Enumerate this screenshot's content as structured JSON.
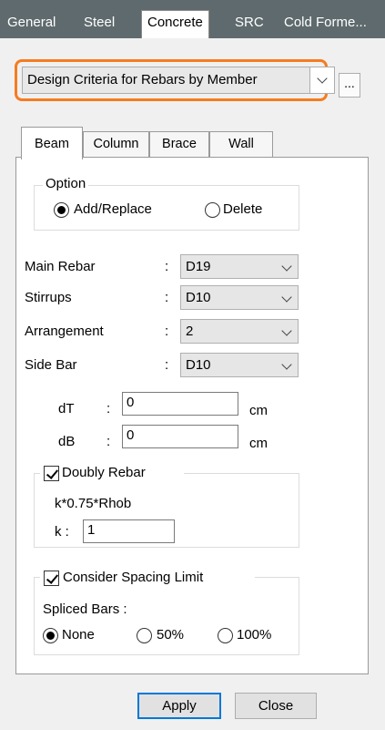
{
  "top_tabs": {
    "general": "General",
    "steel": "Steel",
    "concrete": "Concrete",
    "src": "SRC",
    "cold_formed": "Cold Forme..."
  },
  "criteria": {
    "selected": "Design Criteria for Rebars by Member",
    "more_label": "..."
  },
  "member_tabs": {
    "beam": "Beam",
    "column": "Column",
    "brace": "Brace",
    "wall": "Wall"
  },
  "option": {
    "legend": "Option",
    "add_replace": "Add/Replace",
    "delete": "Delete",
    "selected": "Add/Replace"
  },
  "rebars": {
    "main_rebar": {
      "label": "Main Rebar",
      "colon": ":",
      "value": "D19"
    },
    "stirrups": {
      "label": "Stirrups",
      "colon": ":",
      "value": "D10"
    },
    "arrangement": {
      "label": "Arrangement",
      "colon": ":",
      "value": "2"
    },
    "side_bar": {
      "label": "Side Bar",
      "colon": ":",
      "value": "D10"
    }
  },
  "cover": {
    "dT_label": "dT",
    "dT_colon": ":",
    "dT_value": "0",
    "dT_unit": "cm",
    "dB_label": "dB",
    "dB_colon": ":",
    "dB_value": "0",
    "dB_unit": "cm"
  },
  "doubly": {
    "label": "Doubly Rebar",
    "checked": true,
    "formula": "k*0.75*Rhob",
    "k_label": "k :",
    "k_value": "1"
  },
  "spacing": {
    "label": "Consider Spacing Limit",
    "checked": true,
    "spliced_label": "Spliced Bars :",
    "none": "None",
    "p50": "50%",
    "p100": "100%",
    "selected": "None"
  },
  "buttons": {
    "apply": "Apply",
    "close": "Close"
  },
  "colors": {
    "highlight": "#f57c20",
    "tabbar": "#5f6a6e",
    "default_button_border": "#0078d7"
  }
}
